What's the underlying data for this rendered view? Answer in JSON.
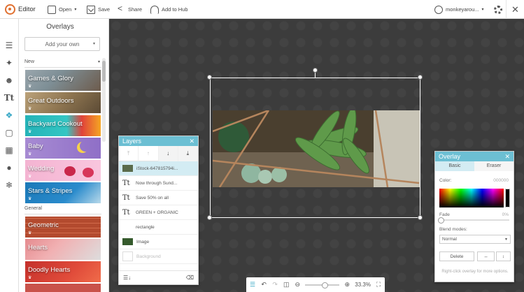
{
  "app": {
    "title": "Editor"
  },
  "topbar": {
    "open_label": "Open",
    "save_label": "Save",
    "share_label": "Share",
    "hub_label": "Add to Hub",
    "user_label": "monkeyarou..."
  },
  "tools": [
    "adjust-icon",
    "magic-wand-icon",
    "face-icon",
    "text-icon",
    "butterfly-icon",
    "frame-icon",
    "texture-icon",
    "apple-icon",
    "snowflake-icon"
  ],
  "overlays": {
    "title": "Overlays",
    "add_label": "Add your own",
    "cat_new": "New",
    "cat_general": "General",
    "new_items": [
      "Games & Glory",
      "Great Outdoors",
      "Backyard Cookout",
      "Baby",
      "Wedding",
      "Stars & Stripes"
    ],
    "general_items": [
      "Geometric",
      "Hearts",
      "Doodly Hearts"
    ]
  },
  "layers": {
    "title": "Layers",
    "rows": [
      {
        "label": "iStock-647815794i...",
        "kind": "photo"
      },
      {
        "label": "Now through Sund...",
        "kind": "text"
      },
      {
        "label": "Save 50% on all",
        "kind": "text"
      },
      {
        "label": "GREEN + ORGANIC",
        "kind": "text"
      },
      {
        "label": "rectangle",
        "kind": "shape"
      },
      {
        "label": "Image",
        "kind": "image"
      },
      {
        "label": "Background",
        "kind": "background"
      }
    ]
  },
  "overlay_panel": {
    "title": "Overlay",
    "tab_basic": "Basic",
    "tab_eraser": "Eraser",
    "color_label": "Color:",
    "color_value": "000000",
    "fade_label": "Fade",
    "fade_value": "0%",
    "blend_label": "Blend modes:",
    "blend_value": "Normal",
    "delete_label": "Delete",
    "help_text": "Right-click overlay for more options."
  },
  "bottombar": {
    "zoom": "33.3%"
  }
}
